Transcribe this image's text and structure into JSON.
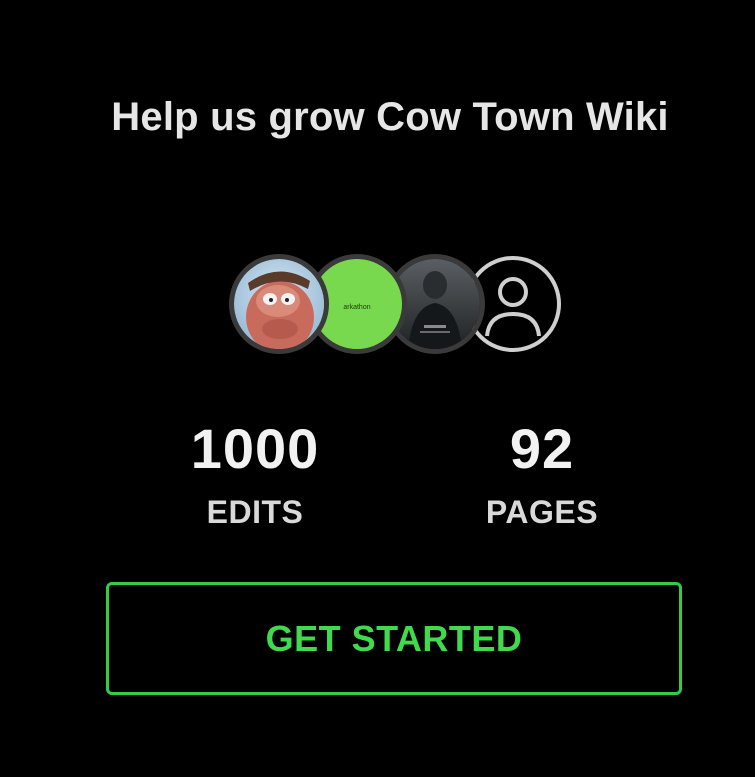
{
  "card": {
    "title": "Help us grow Cow Town Wiki",
    "avatars": [
      {
        "icon": "user-avatar-cartoon"
      },
      {
        "icon": "user-avatar-green",
        "text": "arkathon"
      },
      {
        "icon": "user-avatar-dark-photo"
      },
      {
        "icon": "user-placeholder-icon"
      }
    ],
    "stats": {
      "edits_value": "1000",
      "edits_label": "EDITS",
      "pages_value": "92",
      "pages_label": "PAGES"
    },
    "cta_label": "GET STARTED"
  },
  "colors": {
    "background": "#000000",
    "text": "#e6e6e6",
    "accent": "#3fdb4c",
    "accent_border": "#33cc44",
    "avatar_green": "#78d84e"
  }
}
